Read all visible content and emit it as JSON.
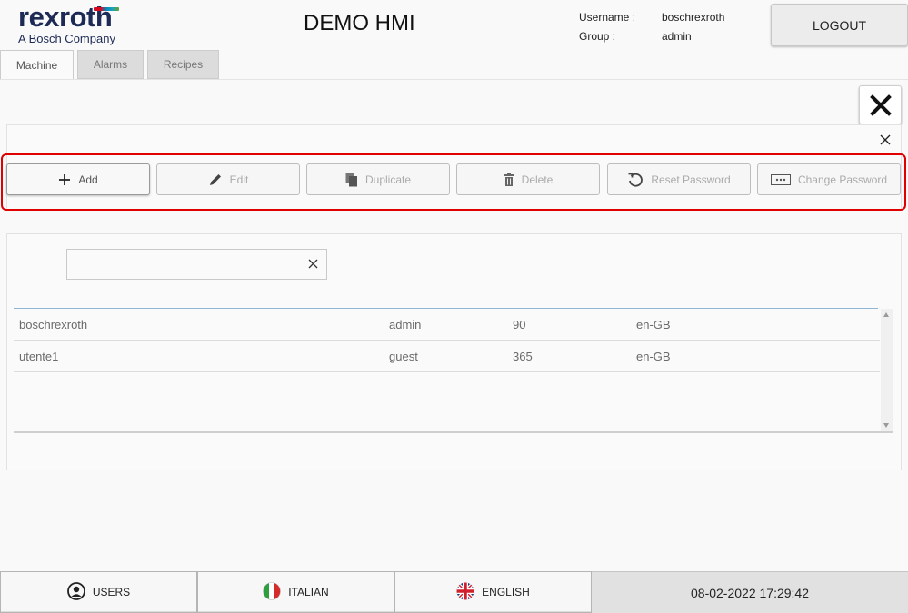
{
  "brand": {
    "name": "rexroth",
    "tagline": "A Bosch Company"
  },
  "header": {
    "title": "DEMO HMI",
    "username_label": "Username :",
    "group_label": "Group :",
    "username": "boschrexroth",
    "group": "admin",
    "logout_label": "LOGOUT"
  },
  "tabs": [
    {
      "label": "Machine",
      "active": true
    },
    {
      "label": "Alarms",
      "active": false
    },
    {
      "label": "Recipes",
      "active": false
    }
  ],
  "toolbar": {
    "add": "Add",
    "edit": "Edit",
    "duplicate": "Duplicate",
    "delete": "Delete",
    "reset_password": "Reset Password",
    "change_password": "Change Password"
  },
  "search": {
    "value": "",
    "placeholder": ""
  },
  "users_table": {
    "rows": [
      [
        "boschrexroth",
        "admin",
        "90",
        "en-GB"
      ],
      [
        "utente1",
        "guest",
        "365",
        "en-GB"
      ]
    ]
  },
  "footer": {
    "users_label": "USERS",
    "italian_label": "ITALIAN",
    "english_label": "ENGLISH",
    "datetime": "08-02-2022 17:29:42"
  },
  "colors": {
    "brand_navy": "#1d2a56",
    "highlight_red": "#e10000",
    "grid_header_line": "#8fb8d8"
  }
}
